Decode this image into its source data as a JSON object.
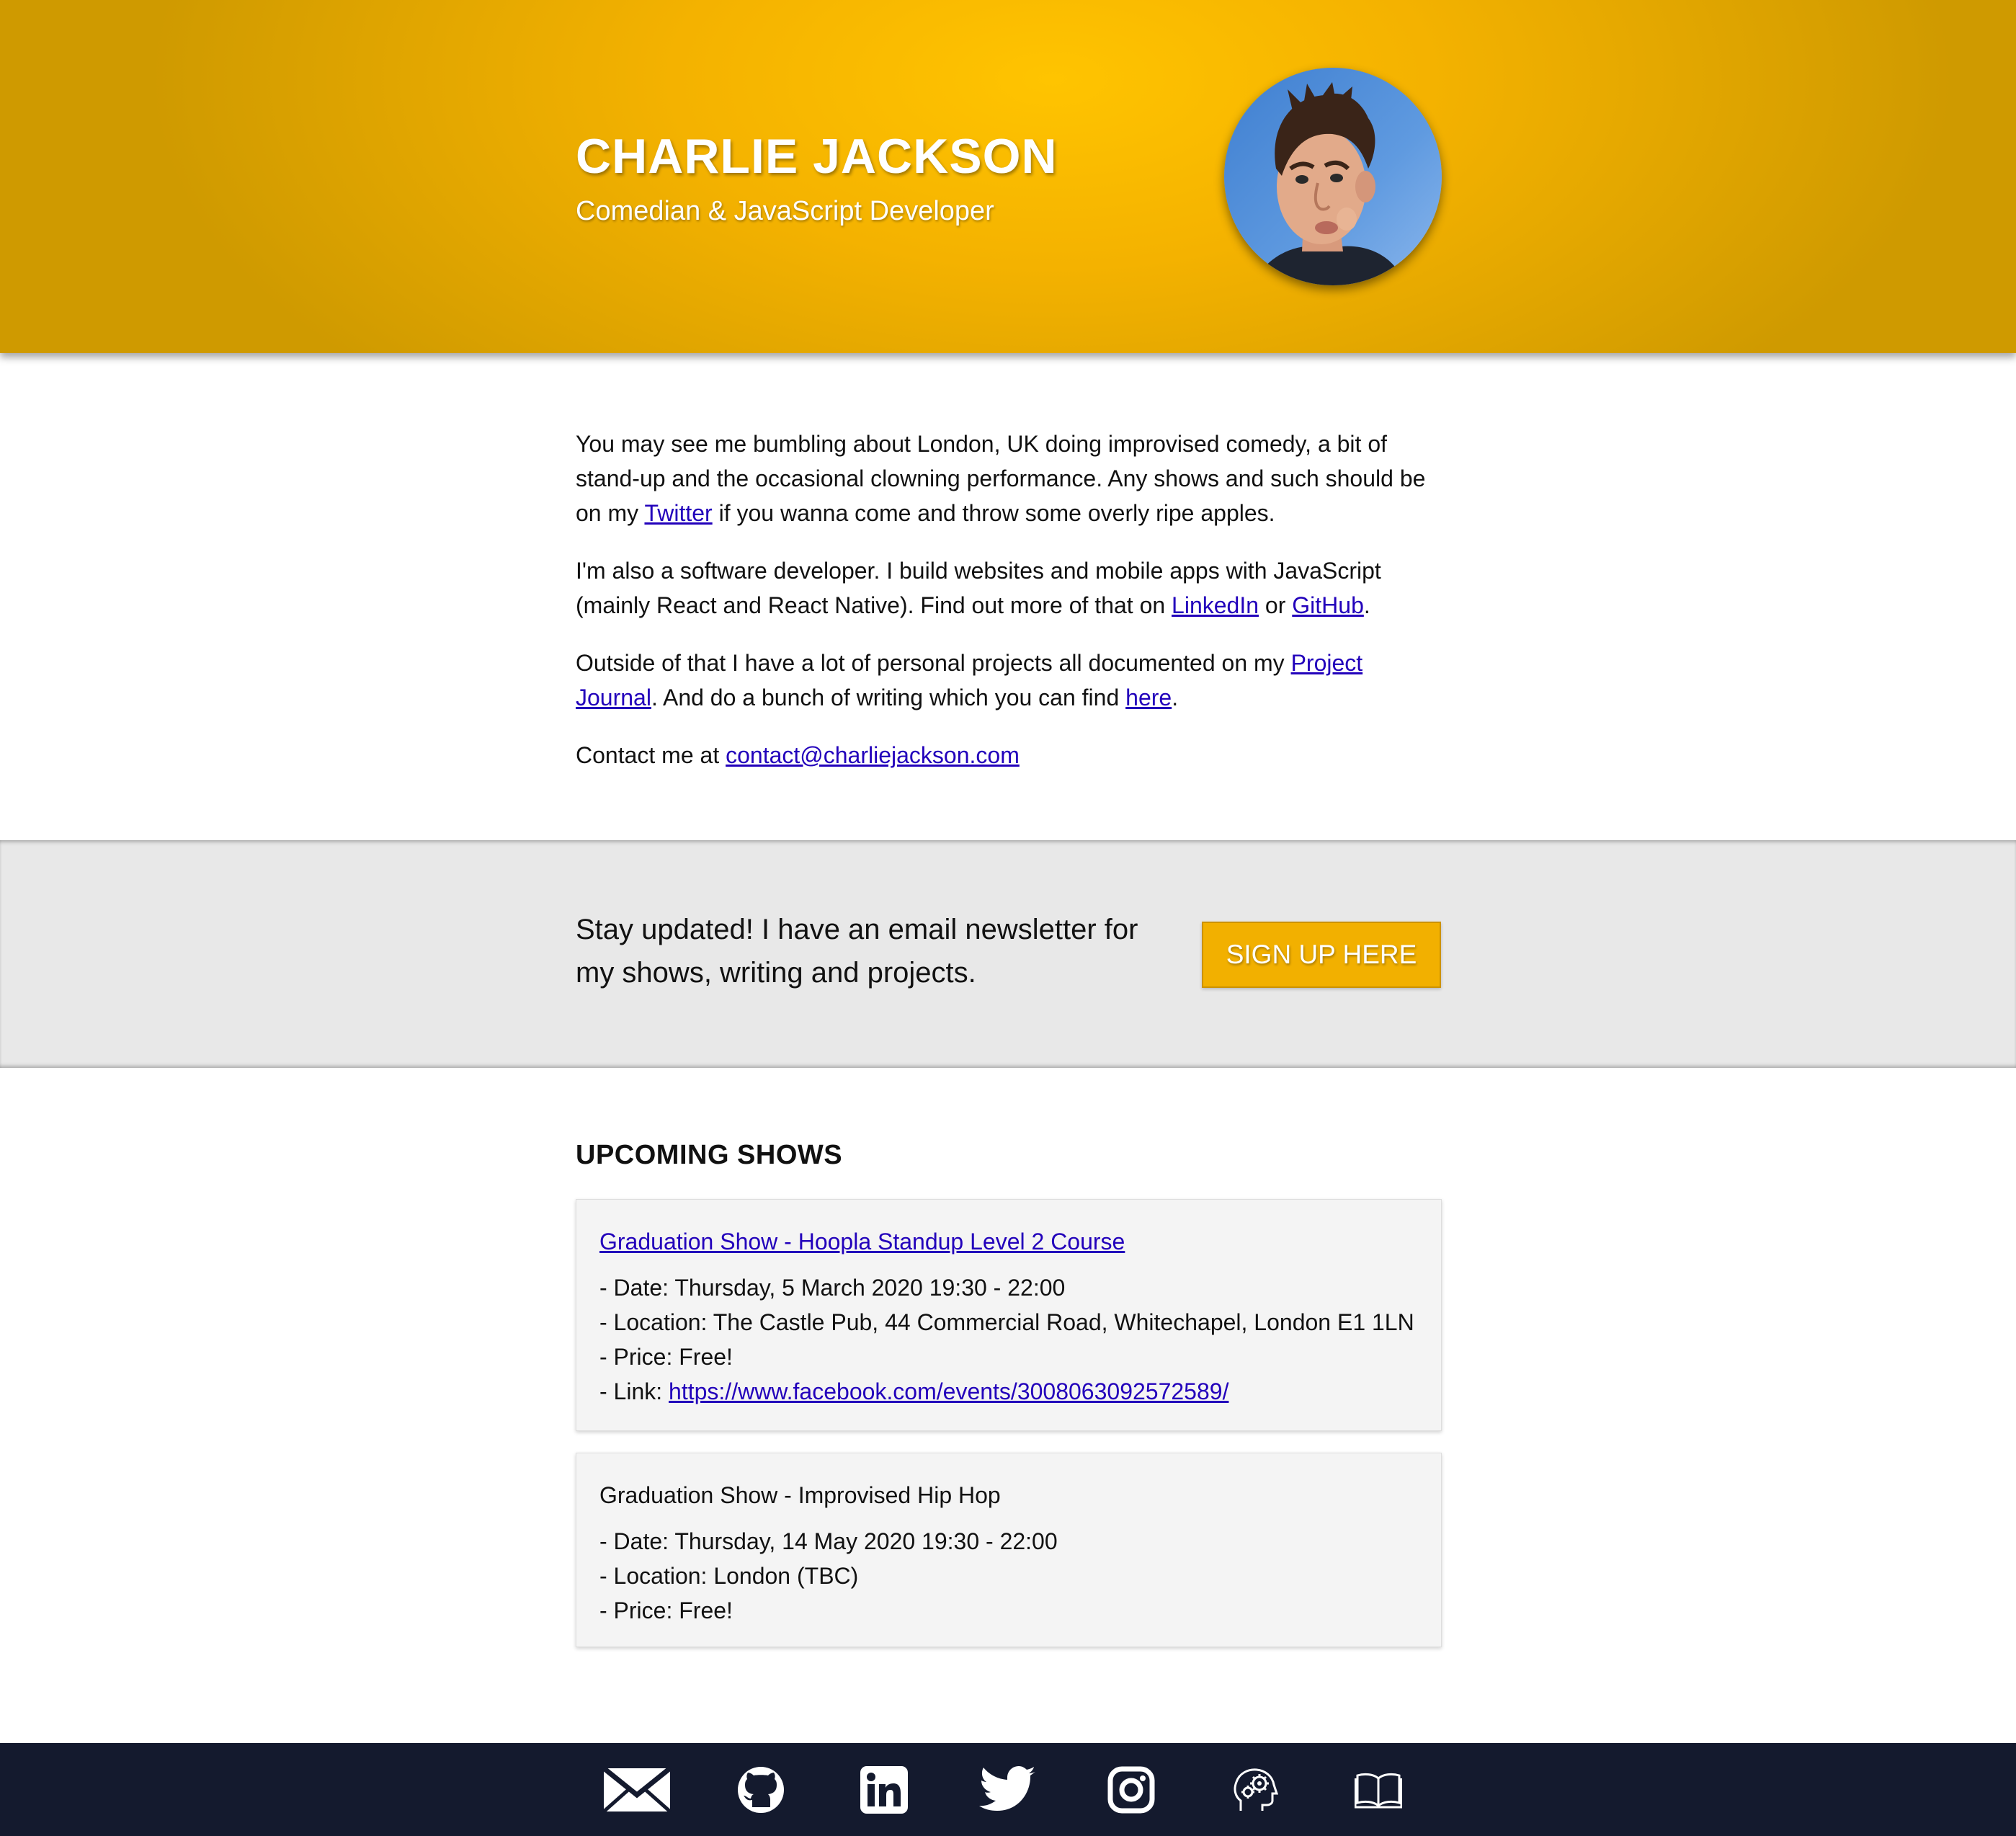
{
  "header": {
    "name": "CHARLIE JACKSON",
    "subtitle": "Comedian & JavaScript Developer",
    "avatar_icon": "portrait-photo"
  },
  "about": {
    "p1_pre": "You may see me bumbling about London, UK doing improvised comedy, a bit of stand-up and the occasional clowning performance. Any shows and such should be on my ",
    "p1_link": "Twitter",
    "p1_post": " if you wanna come and throw some overly ripe apples.",
    "p2_pre": "I'm also a software developer. I build websites and mobile apps with JavaScript (mainly React and React Native). Find out more of that on ",
    "p2_link1": "LinkedIn",
    "p2_mid": " or ",
    "p2_link2": "GitHub",
    "p2_post": ".",
    "p3_pre": "Outside of that I have a lot of personal projects all documented on my ",
    "p3_link1": "Project Journal",
    "p3_mid": ". And do a bunch of writing which you can find ",
    "p3_link2": "here",
    "p3_post": ".",
    "p4_pre": "Contact me at ",
    "p4_link": "contact@charliejackson.com"
  },
  "newsletter": {
    "text": "Stay updated! I have an email newsletter for my shows, writing and projects.",
    "button_label": "SIGN UP HERE"
  },
  "shows": {
    "heading": "UPCOMING SHOWS",
    "items": [
      {
        "title": "Graduation Show - Hoopla Standup Level 2 Course",
        "date": "- Date: Thursday, 5 March 2020 19:30 - 22:00",
        "location": "- Location: The Castle Pub, 44 Commercial Road, Whitechapel, London E1 1LN",
        "price": "- Price: Free!",
        "link_prefix": "- Link: ",
        "link": "https://www.facebook.com/events/3008063092572589/"
      },
      {
        "title": "Graduation Show - Improvised Hip Hop",
        "date": "- Date: Thursday, 14 May 2020 19:30 - 22:00",
        "location": "- Location: London (TBC)",
        "price": "- Price: Free!"
      }
    ]
  },
  "footer": {
    "icons": [
      "email-icon",
      "github-icon",
      "linkedin-icon",
      "twitter-icon",
      "instagram-icon",
      "projects-brain-gear-icon",
      "writing-book-icon"
    ]
  },
  "colors": {
    "header_accent": "#f4b200",
    "button": "#f2b000",
    "link": "#2200bb",
    "footer_bg": "#141a2e",
    "newsletter_bg": "#e8e8e8",
    "card_bg": "#f4f4f4"
  }
}
